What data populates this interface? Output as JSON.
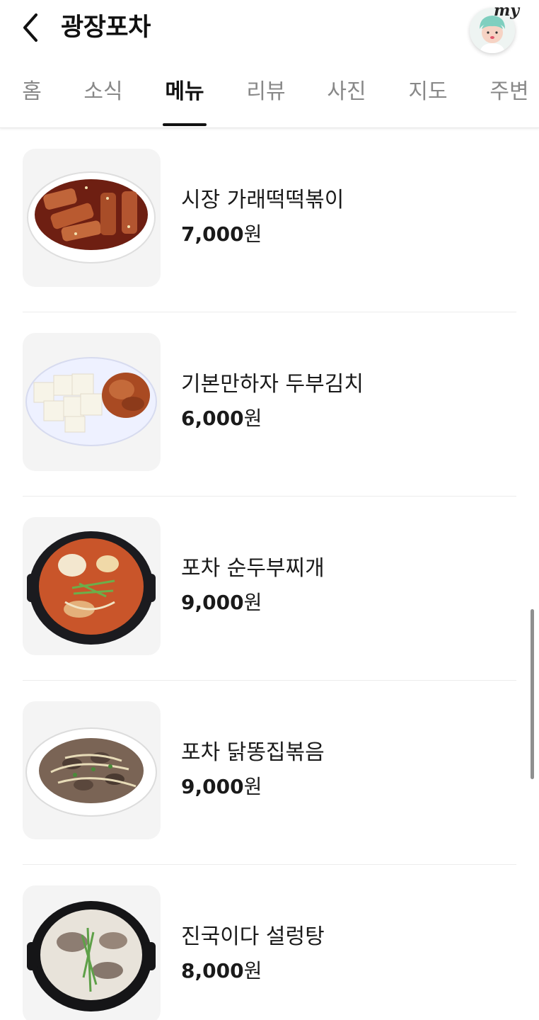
{
  "header": {
    "title": "광장포차",
    "back_icon": "chevron-left-icon",
    "profile_badge": "my",
    "profile_icon": "avatar-icon"
  },
  "tabs": [
    {
      "label": "홈",
      "active": false
    },
    {
      "label": "소식",
      "active": false
    },
    {
      "label": "메뉴",
      "active": true
    },
    {
      "label": "리뷰",
      "active": false
    },
    {
      "label": "사진",
      "active": false
    },
    {
      "label": "지도",
      "active": false
    },
    {
      "label": "주변",
      "active": false
    }
  ],
  "menu": {
    "currency_suffix": "원",
    "items": [
      {
        "name": "시장 가래떡떡볶이",
        "price": "7,000",
        "image_icon": "tteokbokki-dish-image"
      },
      {
        "name": "기본만하자 두부김치",
        "price": "6,000",
        "image_icon": "tofu-kimchi-dish-image"
      },
      {
        "name": "포차 순두부찌개",
        "price": "9,000",
        "image_icon": "sundubu-stew-image"
      },
      {
        "name": "포차 닭똥집볶음",
        "price": "9,000",
        "image_icon": "chicken-gizzard-dish-image"
      },
      {
        "name": "진국이다 설렁탕",
        "price": "8,000",
        "image_icon": "seolleongtang-image"
      }
    ]
  },
  "colors": {
    "text_primary": "#1a1a1a",
    "tab_inactive": "#888888",
    "divider": "#ececec",
    "thumb_bg": "#f4f4f4"
  }
}
